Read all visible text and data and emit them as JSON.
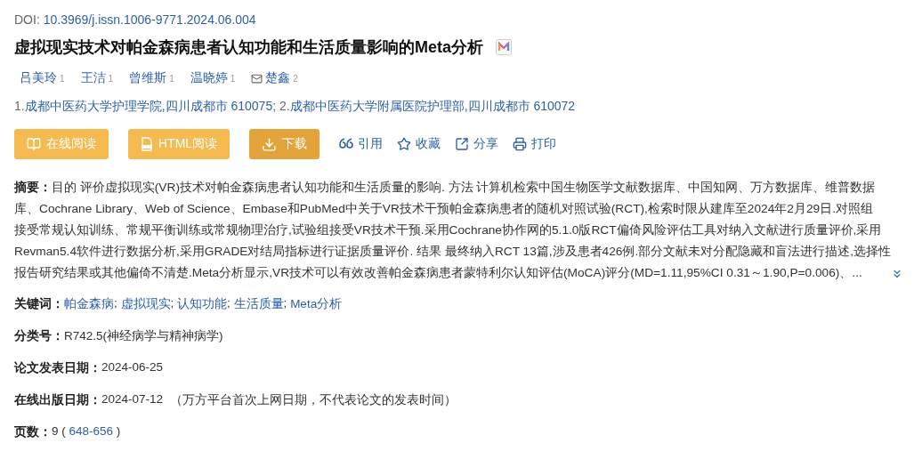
{
  "doi": {
    "label": "DOI:",
    "value": "10.3969/j.issn.1006-9771.2024.06.004"
  },
  "title": "虚拟现实技术对帕金森病患者认知功能和生活质量影响的Meta分析",
  "authors": [
    {
      "name": "吕美玲",
      "sup": "1",
      "corresponding": false
    },
    {
      "name": "王洁",
      "sup": "1",
      "corresponding": false
    },
    {
      "name": "曾维斯",
      "sup": "1",
      "corresponding": false
    },
    {
      "name": "温晓婷",
      "sup": "1",
      "corresponding": false
    },
    {
      "name": "楚鑫",
      "sup": "2",
      "corresponding": true
    }
  ],
  "affiliations": {
    "separator": ";",
    "items": [
      {
        "index": "1.",
        "name": "成都中医药大学护理学院,四川成都市 610075"
      },
      {
        "index": "2.",
        "name": "成都中医药大学附属医院护理部,四川成都市 610072"
      }
    ]
  },
  "actions": [
    {
      "kind": "read",
      "label": "在线阅读"
    },
    {
      "kind": "html",
      "label": "HTML阅读"
    },
    {
      "kind": "download",
      "label": "下载"
    },
    {
      "kind": "cite",
      "label": "引用"
    },
    {
      "kind": "favorite",
      "label": "收藏"
    },
    {
      "kind": "share",
      "label": "分享"
    },
    {
      "kind": "print",
      "label": "打印"
    }
  ],
  "abstract": {
    "label": "摘要：",
    "lines": [
      "目的 评价虚拟现实(VR)技术对帕金森病患者认知功能和生活质量的影响. 方法 计算机检索中国生物医学文献数据库、中国知网、万方数据库、维普数据",
      "库、Cochrane Library、Web of Science、Embase和PubMed中关于VR技术干预帕金森病患者的随机对照试验(RCT),检索时限从建库至2024年2月29日.对照组",
      "接受常规认知训练、常规平衡训练或常规物理治疗,试验组接受VR技术干预.采用Cochrane协作网的5.1.0版RCT偏倚风险评估工具对纳入文献进行质量评价,采用",
      "Revman5.4软件进行数据分析,采用GRADE对结局指标进行证据质量评价. 结果 最终纳入RCT 13篇,涉及患者426例.部分文献未对分配隐藏和盲法进行描述,选择性",
      "报告研究结果或其他偏倚不清楚.Meta分析显示,VR技术可以有效改善帕金森病患者蒙特利尔认知评估(MoCA)评分(MD=1.11,95%CI 0.31～1.90,P=0.006)、..."
    ],
    "expanded": false
  },
  "keywords": {
    "label": "关键词：",
    "separator": ";",
    "items": [
      "帕金森病",
      "虚拟现实",
      "认知功能",
      "生活质量",
      "Meta分析"
    ]
  },
  "classification": {
    "label": "分类号：",
    "value": "R742.5(神经病学与精神病学)"
  },
  "publish_date": {
    "label": "论文发表日期：",
    "value": "2024-06-25"
  },
  "online_date": {
    "label": "在线出版日期：",
    "value": "2024-07-12",
    "note": "（万方平台首次上网日期，不代表论文的发表时间）"
  },
  "pages": {
    "label": "页数：",
    "count": "9",
    "open": "(",
    "range": "648-656",
    "close": ")"
  }
}
